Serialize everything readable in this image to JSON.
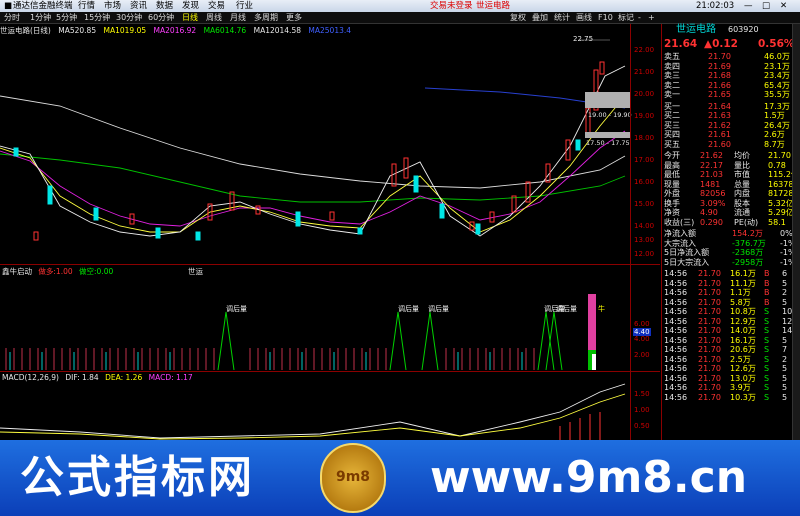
{
  "titlebar": {
    "app_title": "通达信金融终端",
    "menu": [
      "行情",
      "市场",
      "资讯",
      "数据",
      "发现",
      "交易",
      "行业"
    ],
    "center_left": "交易未登录",
    "center_right": "世运电路",
    "clock": "21:02:03"
  },
  "toolbar": {
    "items": [
      "分时",
      "1分钟",
      "5分钟",
      "15分钟",
      "30分钟",
      "60分钟",
      "日线",
      "周线",
      "月线",
      "多周期",
      "更多"
    ],
    "active_index": 6,
    "right_items": [
      "复权",
      "叠加",
      "统计",
      "画线",
      "F10",
      "标记",
      "-",
      "+"
    ]
  },
  "main": {
    "stock_label": "世运电路(日线)",
    "ma": [
      {
        "name": "MA5",
        "value": "20.85"
      },
      {
        "name": "MA10",
        "value": "19.05"
      },
      {
        "name": "MA20",
        "value": "16.92"
      },
      {
        "name": "MA60",
        "value": "14.76"
      },
      {
        "name": "MA120",
        "value": "14.58"
      },
      {
        "name": "MA250",
        "value": "13.4"
      }
    ],
    "axis": [
      "22.00",
      "21.00",
      "20.00",
      "19.00",
      "18.00",
      "17.00",
      "16.00",
      "15.00",
      "14.00",
      "13.00",
      "12.00"
    ],
    "high_label": "22.75",
    "box1": "19.00 - 19.90",
    "box2": "17.50 - 17.75"
  },
  "ind1": {
    "name": "鑫牛启动",
    "line1": "做多:1.00",
    "line2": "做空:0.00",
    "caption": "世运",
    "labels": [
      "调后量",
      "调后量",
      "调后量",
      "调后量",
      "调后量"
    ],
    "side_text": "牛",
    "axis": [
      "6.00",
      "4.00",
      "2.00"
    ],
    "marker": "4.40"
  },
  "macd": {
    "label": "MACD(12,26,9)",
    "dif": "DIF: 1.84",
    "dea": "DEA: 1.26",
    "macd": "MACD: 1.17",
    "axis": [
      "1.50",
      "1.00",
      "0.50"
    ]
  },
  "quote": {
    "code": "603920",
    "name": "世运电路",
    "price": "21.64",
    "change": "▲0.12",
    "pct": "0.56%",
    "asks": [
      [
        "卖五",
        "21.70",
        "46.0万"
      ],
      [
        "卖四",
        "21.69",
        "23.1万"
      ],
      [
        "卖三",
        "21.68",
        "23.4万"
      ],
      [
        "卖二",
        "21.66",
        "65.4万"
      ],
      [
        "卖一",
        "21.65",
        "35.5万"
      ]
    ],
    "bids": [
      [
        "买一",
        "21.64",
        "17.3万"
      ],
      [
        "买二",
        "21.63",
        "1.5万"
      ],
      [
        "买三",
        "21.62",
        "26.4万"
      ],
      [
        "买四",
        "21.61",
        "2.6万"
      ],
      [
        "买五",
        "21.60",
        "8.7万"
      ]
    ],
    "stats": [
      [
        "今开",
        "21.62",
        "均价",
        "21.70"
      ],
      [
        "最高",
        "22.17",
        "量比",
        "0.78"
      ],
      [
        "最低",
        "21.03",
        "市值",
        "115.2亿"
      ],
      [
        "现量",
        "1481",
        "总量",
        "16378"
      ],
      [
        "外盘",
        "82056",
        "内盘",
        "81728"
      ],
      [
        "换手",
        "3.09%",
        "股本",
        "5.32亿"
      ],
      [
        "净资",
        "4.90",
        "流通",
        "5.29亿"
      ],
      [
        "收益(三)",
        "0.290",
        "PE(动)",
        "58.1"
      ]
    ],
    "flows": [
      [
        "净流入额",
        "154.2万",
        "0%"
      ],
      [
        "大宗流入",
        "-376.7万",
        "-1%"
      ],
      [
        "5日净流入额",
        "-2368万",
        "-1%"
      ],
      [
        "5日大宗流入",
        "-2958万",
        "-1%"
      ]
    ],
    "ticks": [
      [
        "14:56",
        "21.70",
        "16.1万",
        "B",
        "6"
      ],
      [
        "14:56",
        "21.70",
        "11.1万",
        "B",
        "5"
      ],
      [
        "14:56",
        "21.70",
        "1.1万",
        "B",
        "2"
      ],
      [
        "14:56",
        "21.70",
        "5.8万",
        "B",
        "5"
      ],
      [
        "14:56",
        "21.70",
        "10.8万",
        "S",
        "10"
      ],
      [
        "14:56",
        "21.70",
        "12.9万",
        "S",
        "12"
      ],
      [
        "14:56",
        "21.70",
        "14.0万",
        "S",
        "14"
      ],
      [
        "14:56",
        "21.70",
        "16.1万",
        "S",
        "5"
      ],
      [
        "14:56",
        "21.70",
        "20.6万",
        "S",
        "7"
      ],
      [
        "14:56",
        "21.70",
        "2.5万",
        "S",
        "2"
      ],
      [
        "14:56",
        "21.70",
        "12.6万",
        "S",
        "5"
      ],
      [
        "14:56",
        "21.70",
        "13.0万",
        "S",
        "5"
      ],
      [
        "14:56",
        "21.70",
        "3.9万",
        "S",
        "5"
      ],
      [
        "14:56",
        "21.70",
        "10.3万",
        "S",
        "5"
      ]
    ]
  },
  "banner": {
    "left": "公式指标网",
    "right": "www.9m8.cn",
    "logo_text": "9m8"
  },
  "colors": {
    "up": "#ff3232",
    "down": "#00e6e6",
    "border": "#8b0000"
  }
}
